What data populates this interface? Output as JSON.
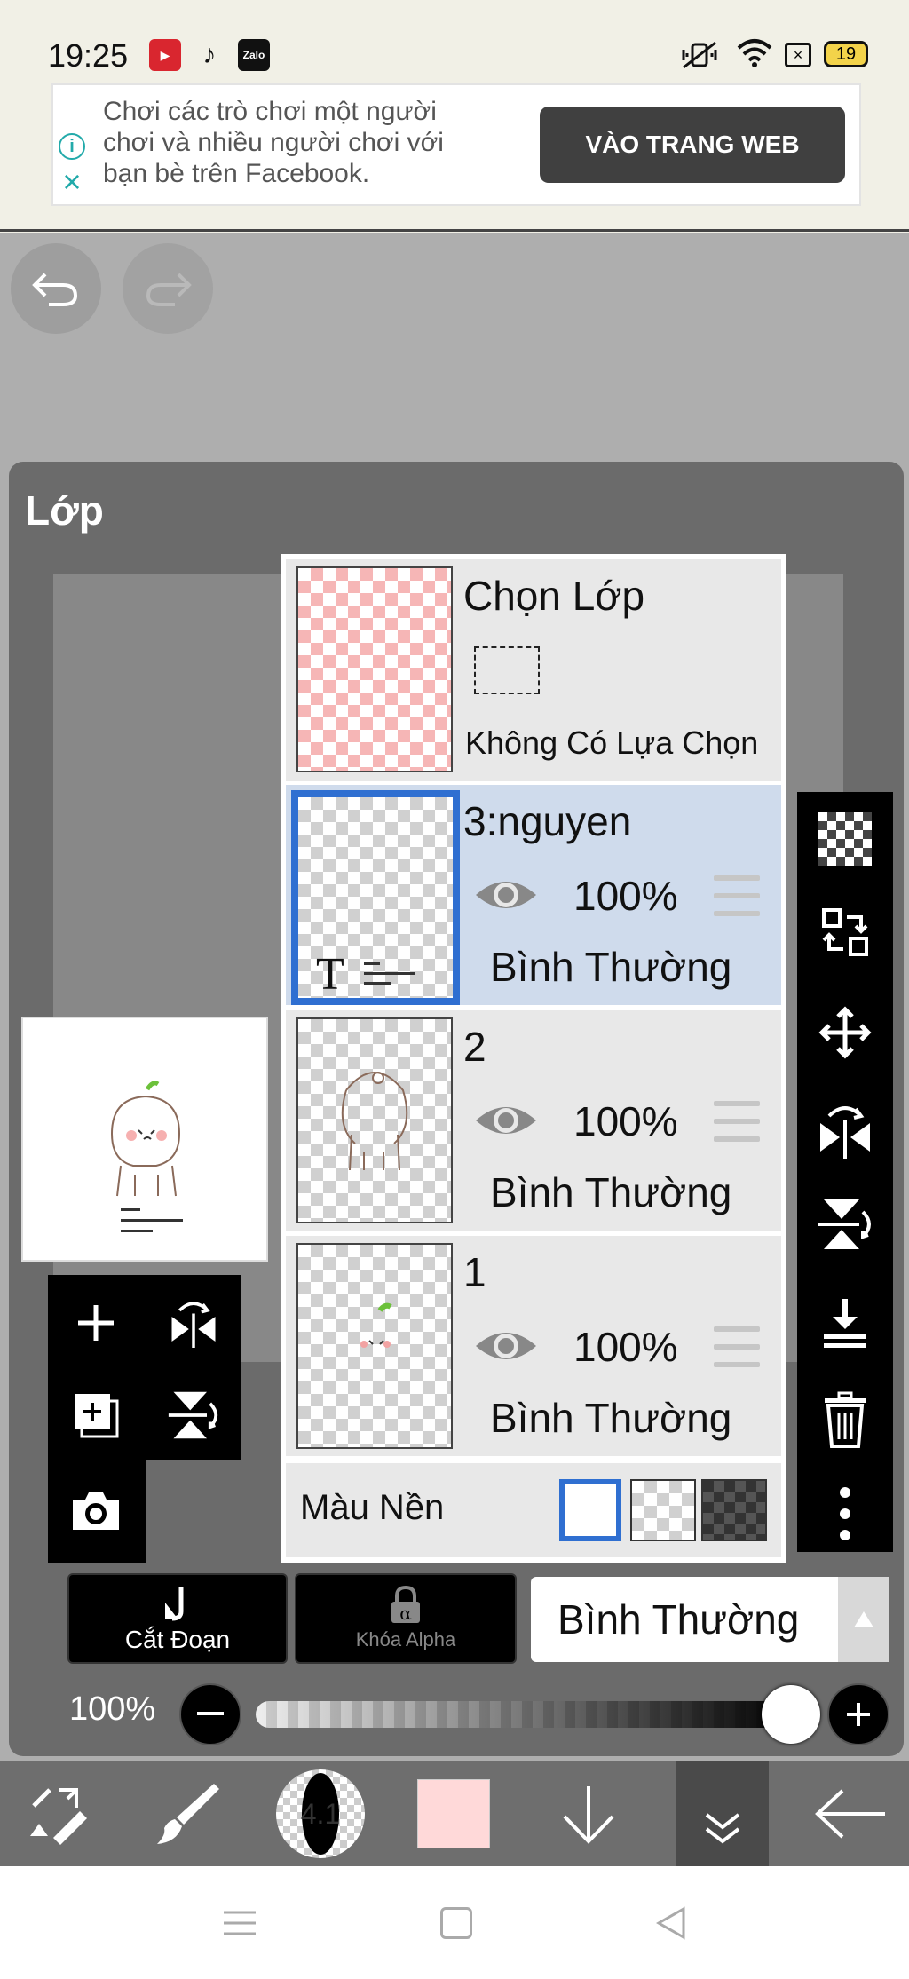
{
  "status_bar": {
    "time": "19:25",
    "battery": "19",
    "app_icons": [
      "youtube-like-icon",
      "tiktok-icon",
      "zalo-icon"
    ]
  },
  "ad": {
    "text": "Chơi các trò chơi một người chơi và nhiều người chơi với bạn bè trên Facebook.",
    "button": "VÀO TRANG WEB"
  },
  "panel": {
    "title": "Lớp",
    "selection": {
      "title": "Chọn Lớp",
      "subtitle": "Không Có Lựa Chọn"
    },
    "layers": [
      {
        "name": "3:nguyen",
        "opacity": "100%",
        "mode": "Bình Thường",
        "active": true
      },
      {
        "name": "2",
        "opacity": "100%",
        "mode": "Bình Thường",
        "active": false
      },
      {
        "name": "1",
        "opacity": "100%",
        "mode": "Bình Thường",
        "active": false
      }
    ],
    "background_label": "Màu Nền",
    "clipping_label": "Cắt Đoạn",
    "alpha_lock_label": "Khóa Alpha",
    "blend_mode": "Bình Thường",
    "opacity_label": "100%"
  },
  "toolbar": {
    "brush_size": "4.1",
    "color": "#ffd9d9"
  },
  "colors": {
    "accent_blue": "#2f6fd1",
    "active_layer": "#cfdbec"
  }
}
